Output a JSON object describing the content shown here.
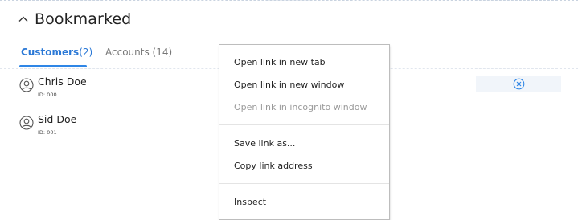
{
  "section": {
    "title": "Bookmarked",
    "collapse_icon": "chevron-up-icon"
  },
  "tabs": [
    {
      "label": "Customers",
      "count": "(2)"
    },
    {
      "label": "Accounts",
      "count": "(14)"
    }
  ],
  "customers": [
    {
      "name": "Chris Doe",
      "id": "ID: 000"
    },
    {
      "name": "Sid Doe",
      "id": "ID: 001"
    }
  ],
  "colors": {
    "accent": "#2f86e6",
    "tab_active_text": "#2a78d6",
    "disabled_text": "#9a9a9a"
  },
  "context_menu": {
    "items": [
      {
        "label": "Open link in new tab"
      },
      {
        "label": "Open link in new window"
      },
      {
        "label": "Open link in incognito window",
        "disabled": true
      },
      {
        "label": "Save link as..."
      },
      {
        "label": "Copy link address"
      },
      {
        "label": "Inspect"
      }
    ]
  }
}
